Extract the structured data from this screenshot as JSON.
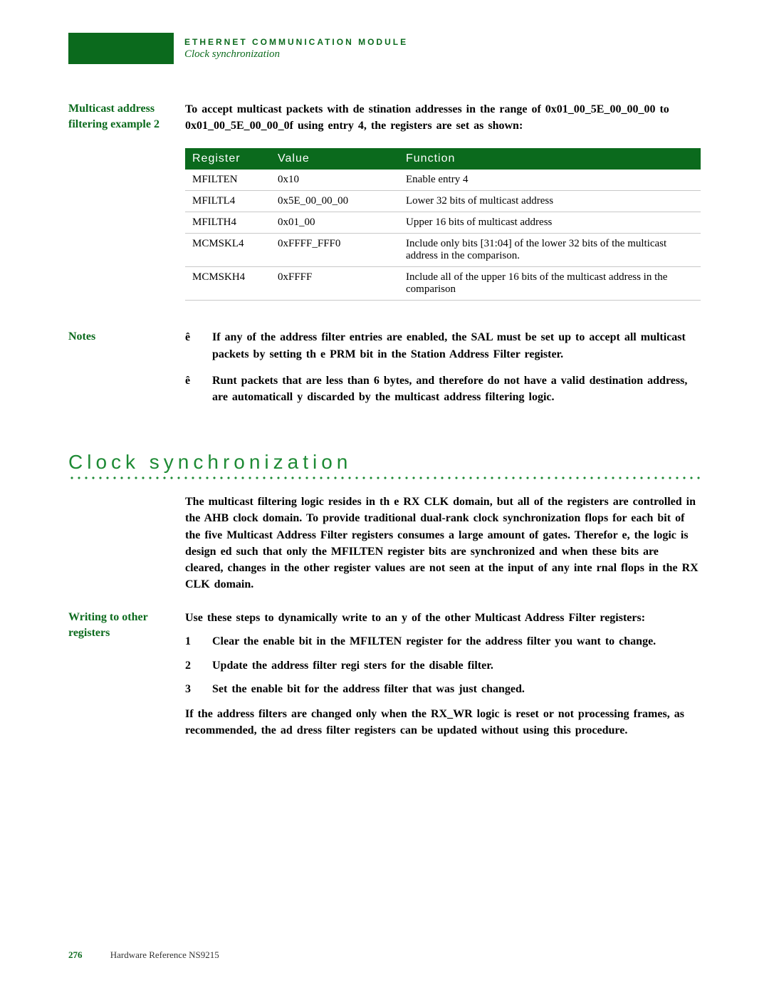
{
  "header": {
    "title": "ETHERNET COMMUNICATION MODULE",
    "subtitle": "Clock synchronization"
  },
  "sections": {
    "example": {
      "side_label": "Multicast address filtering example 2",
      "intro": "To accept multicast packets with de    stination addresses in the range of 0x01_00_5E_00_00_00 to 0x01_00_5E_00_00_0f using entry 4, the registers are set as shown:",
      "table": {
        "headers": {
          "c1": "Register",
          "c2": "Value",
          "c3": "Function"
        },
        "rows": [
          {
            "reg": "MFILTEN",
            "val": "0x10",
            "func": "Enable entry 4"
          },
          {
            "reg": "MFILTL4",
            "val": "0x5E_00_00_00",
            "func": "Lower 32 bits of multicast address"
          },
          {
            "reg": "MFILTH4",
            "val": "0x01_00",
            "func": "Upper 16 bits of multicast address"
          },
          {
            "reg": "MCMSKL4",
            "val": "0xFFFF_FFF0",
            "func": "Include only bits [31:04] of the lower 32 bits of the multicast address in the comparison."
          },
          {
            "reg": "MCMSKH4",
            "val": "0xFFFF",
            "func": "Include all of the upper 16 bits of the multicast address in the comparison"
          }
        ]
      }
    },
    "notes": {
      "side_label": "Notes",
      "items": [
        "If any of the address filter entries are enabled, the SAL must be set up to accept all multicast packets by setting th     e PRM bit in the Station Address Filter register.",
        "Runt packets that are less than 6 bytes, and therefore do not have a valid destination address, are automaticall    y discarded by the multicast address filtering logic."
      ],
      "bullet": "ê"
    },
    "clock": {
      "heading": "Clock synchronization",
      "para": "The multicast filtering logic resides in th    e RX CLK domain, but all of the registers are controlled in the AHB clock domain.    To provide traditional dual-rank clock synchronization flops for each bit of the     five Multicast Address Filter registers consumes a large amount of gates. Therefor    e, the logic is design   ed such that only the MFILTEN register bits are synchronized and when these bits are cleared, changes in the other register values are not seen at     the input of any inte   rnal flops in the RX CLK domain."
    },
    "writing": {
      "side_label": "Writing to other registers",
      "intro": "Use these steps to dynamically write to an    y of the other Multicast Address Filter registers:",
      "steps": [
        "Clear the enable bit in the MFILTEN register for the address filter you want to change.",
        "Update the address filter regi   sters for the disable filter.",
        "Set the enable bit for the address filter that was just changed."
      ],
      "post_prefix": "If the address filters are changed only when the ",
      "post_code": "RX_WR",
      "post_suffix": " logic is reset or not processing frames, as recommended, the ad    dress filter registers can be updated without using this procedure."
    }
  },
  "footer": {
    "page": "276",
    "doc": "Hardware Reference NS9215"
  }
}
